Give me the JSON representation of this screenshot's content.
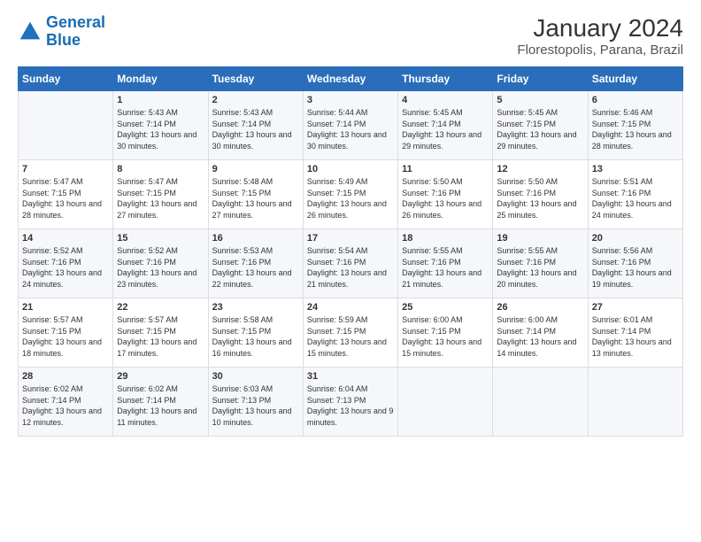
{
  "logo": {
    "line1": "General",
    "line2": "Blue"
  },
  "title": "January 2024",
  "subtitle": "Florestopolis, Parana, Brazil",
  "headers": [
    "Sunday",
    "Monday",
    "Tuesday",
    "Wednesday",
    "Thursday",
    "Friday",
    "Saturday"
  ],
  "weeks": [
    [
      {
        "day": "",
        "sunrise": "",
        "sunset": "",
        "daylight": ""
      },
      {
        "day": "1",
        "sunrise": "Sunrise: 5:43 AM",
        "sunset": "Sunset: 7:14 PM",
        "daylight": "Daylight: 13 hours and 30 minutes."
      },
      {
        "day": "2",
        "sunrise": "Sunrise: 5:43 AM",
        "sunset": "Sunset: 7:14 PM",
        "daylight": "Daylight: 13 hours and 30 minutes."
      },
      {
        "day": "3",
        "sunrise": "Sunrise: 5:44 AM",
        "sunset": "Sunset: 7:14 PM",
        "daylight": "Daylight: 13 hours and 30 minutes."
      },
      {
        "day": "4",
        "sunrise": "Sunrise: 5:45 AM",
        "sunset": "Sunset: 7:14 PM",
        "daylight": "Daylight: 13 hours and 29 minutes."
      },
      {
        "day": "5",
        "sunrise": "Sunrise: 5:45 AM",
        "sunset": "Sunset: 7:15 PM",
        "daylight": "Daylight: 13 hours and 29 minutes."
      },
      {
        "day": "6",
        "sunrise": "Sunrise: 5:46 AM",
        "sunset": "Sunset: 7:15 PM",
        "daylight": "Daylight: 13 hours and 28 minutes."
      }
    ],
    [
      {
        "day": "7",
        "sunrise": "Sunrise: 5:47 AM",
        "sunset": "Sunset: 7:15 PM",
        "daylight": "Daylight: 13 hours and 28 minutes."
      },
      {
        "day": "8",
        "sunrise": "Sunrise: 5:47 AM",
        "sunset": "Sunset: 7:15 PM",
        "daylight": "Daylight: 13 hours and 27 minutes."
      },
      {
        "day": "9",
        "sunrise": "Sunrise: 5:48 AM",
        "sunset": "Sunset: 7:15 PM",
        "daylight": "Daylight: 13 hours and 27 minutes."
      },
      {
        "day": "10",
        "sunrise": "Sunrise: 5:49 AM",
        "sunset": "Sunset: 7:15 PM",
        "daylight": "Daylight: 13 hours and 26 minutes."
      },
      {
        "day": "11",
        "sunrise": "Sunrise: 5:50 AM",
        "sunset": "Sunset: 7:16 PM",
        "daylight": "Daylight: 13 hours and 26 minutes."
      },
      {
        "day": "12",
        "sunrise": "Sunrise: 5:50 AM",
        "sunset": "Sunset: 7:16 PM",
        "daylight": "Daylight: 13 hours and 25 minutes."
      },
      {
        "day": "13",
        "sunrise": "Sunrise: 5:51 AM",
        "sunset": "Sunset: 7:16 PM",
        "daylight": "Daylight: 13 hours and 24 minutes."
      }
    ],
    [
      {
        "day": "14",
        "sunrise": "Sunrise: 5:52 AM",
        "sunset": "Sunset: 7:16 PM",
        "daylight": "Daylight: 13 hours and 24 minutes."
      },
      {
        "day": "15",
        "sunrise": "Sunrise: 5:52 AM",
        "sunset": "Sunset: 7:16 PM",
        "daylight": "Daylight: 13 hours and 23 minutes."
      },
      {
        "day": "16",
        "sunrise": "Sunrise: 5:53 AM",
        "sunset": "Sunset: 7:16 PM",
        "daylight": "Daylight: 13 hours and 22 minutes."
      },
      {
        "day": "17",
        "sunrise": "Sunrise: 5:54 AM",
        "sunset": "Sunset: 7:16 PM",
        "daylight": "Daylight: 13 hours and 21 minutes."
      },
      {
        "day": "18",
        "sunrise": "Sunrise: 5:55 AM",
        "sunset": "Sunset: 7:16 PM",
        "daylight": "Daylight: 13 hours and 21 minutes."
      },
      {
        "day": "19",
        "sunrise": "Sunrise: 5:55 AM",
        "sunset": "Sunset: 7:16 PM",
        "daylight": "Daylight: 13 hours and 20 minutes."
      },
      {
        "day": "20",
        "sunrise": "Sunrise: 5:56 AM",
        "sunset": "Sunset: 7:16 PM",
        "daylight": "Daylight: 13 hours and 19 minutes."
      }
    ],
    [
      {
        "day": "21",
        "sunrise": "Sunrise: 5:57 AM",
        "sunset": "Sunset: 7:15 PM",
        "daylight": "Daylight: 13 hours and 18 minutes."
      },
      {
        "day": "22",
        "sunrise": "Sunrise: 5:57 AM",
        "sunset": "Sunset: 7:15 PM",
        "daylight": "Daylight: 13 hours and 17 minutes."
      },
      {
        "day": "23",
        "sunrise": "Sunrise: 5:58 AM",
        "sunset": "Sunset: 7:15 PM",
        "daylight": "Daylight: 13 hours and 16 minutes."
      },
      {
        "day": "24",
        "sunrise": "Sunrise: 5:59 AM",
        "sunset": "Sunset: 7:15 PM",
        "daylight": "Daylight: 13 hours and 15 minutes."
      },
      {
        "day": "25",
        "sunrise": "Sunrise: 6:00 AM",
        "sunset": "Sunset: 7:15 PM",
        "daylight": "Daylight: 13 hours and 15 minutes."
      },
      {
        "day": "26",
        "sunrise": "Sunrise: 6:00 AM",
        "sunset": "Sunset: 7:14 PM",
        "daylight": "Daylight: 13 hours and 14 minutes."
      },
      {
        "day": "27",
        "sunrise": "Sunrise: 6:01 AM",
        "sunset": "Sunset: 7:14 PM",
        "daylight": "Daylight: 13 hours and 13 minutes."
      }
    ],
    [
      {
        "day": "28",
        "sunrise": "Sunrise: 6:02 AM",
        "sunset": "Sunset: 7:14 PM",
        "daylight": "Daylight: 13 hours and 12 minutes."
      },
      {
        "day": "29",
        "sunrise": "Sunrise: 6:02 AM",
        "sunset": "Sunset: 7:14 PM",
        "daylight": "Daylight: 13 hours and 11 minutes."
      },
      {
        "day": "30",
        "sunrise": "Sunrise: 6:03 AM",
        "sunset": "Sunset: 7:13 PM",
        "daylight": "Daylight: 13 hours and 10 minutes."
      },
      {
        "day": "31",
        "sunrise": "Sunrise: 6:04 AM",
        "sunset": "Sunset: 7:13 PM",
        "daylight": "Daylight: 13 hours and 9 minutes."
      },
      {
        "day": "",
        "sunrise": "",
        "sunset": "",
        "daylight": ""
      },
      {
        "day": "",
        "sunrise": "",
        "sunset": "",
        "daylight": ""
      },
      {
        "day": "",
        "sunrise": "",
        "sunset": "",
        "daylight": ""
      }
    ]
  ]
}
